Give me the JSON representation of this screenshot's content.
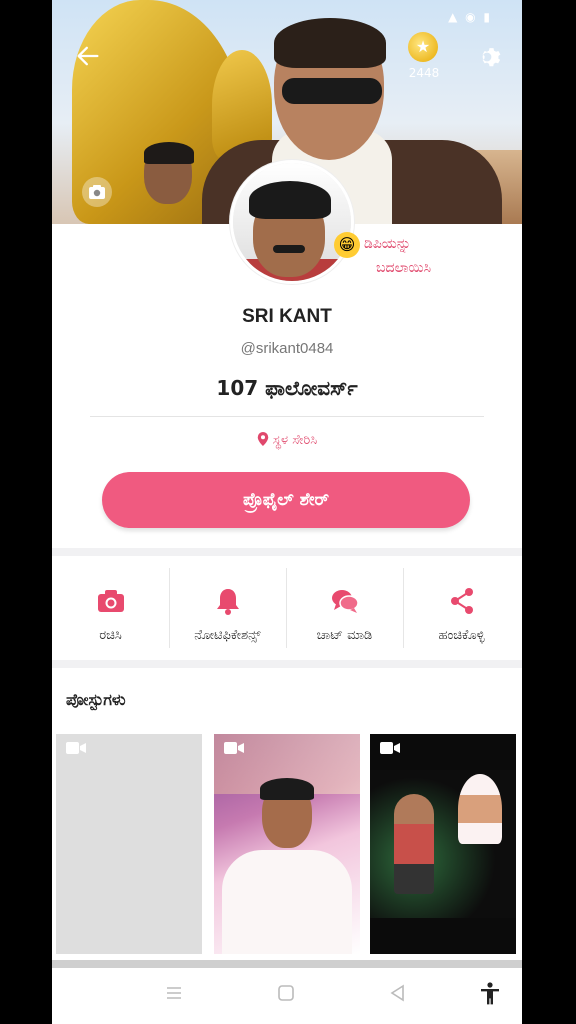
{
  "status_bar": {
    "time": "",
    "icons": "▲ ◉ ▮"
  },
  "header": {
    "back_icon": "arrow-left-icon",
    "coin_count": "2448",
    "settings_icon": "gear-icon"
  },
  "profile": {
    "change_dp_label_line1": "ಡಿಪಿಯನ್ನು",
    "change_dp_label_line2": "ಬದಲಾಯಿಸಿ",
    "name": "SRI KANT",
    "handle": "@srikant0484",
    "followers": "107 ಫಾಲೋವರ್ಸ್",
    "location": "ಸ್ಥಳ ಸೇರಿಸಿ",
    "share_button": "ಪ್ರೊಫೈಲ್ ಶೇರ್"
  },
  "actions": [
    {
      "label": "ರಚಿಸಿ",
      "icon": "camera-icon"
    },
    {
      "label": "ನೋಟಿಫಿಕೇಶನ್ಸ್",
      "icon": "bell-icon"
    },
    {
      "label": "ಚಾಟ್ ಮಾಡಿ",
      "icon": "chat-icon"
    },
    {
      "label": "ಹಂಚಿಕೊಳ್ಳಿ",
      "icon": "share-icon"
    }
  ],
  "posts": {
    "title": "ಪೋಸ್ಟುಗಳು"
  },
  "colors": {
    "accent": "#f05a80",
    "accent_text": "#e0486c"
  }
}
